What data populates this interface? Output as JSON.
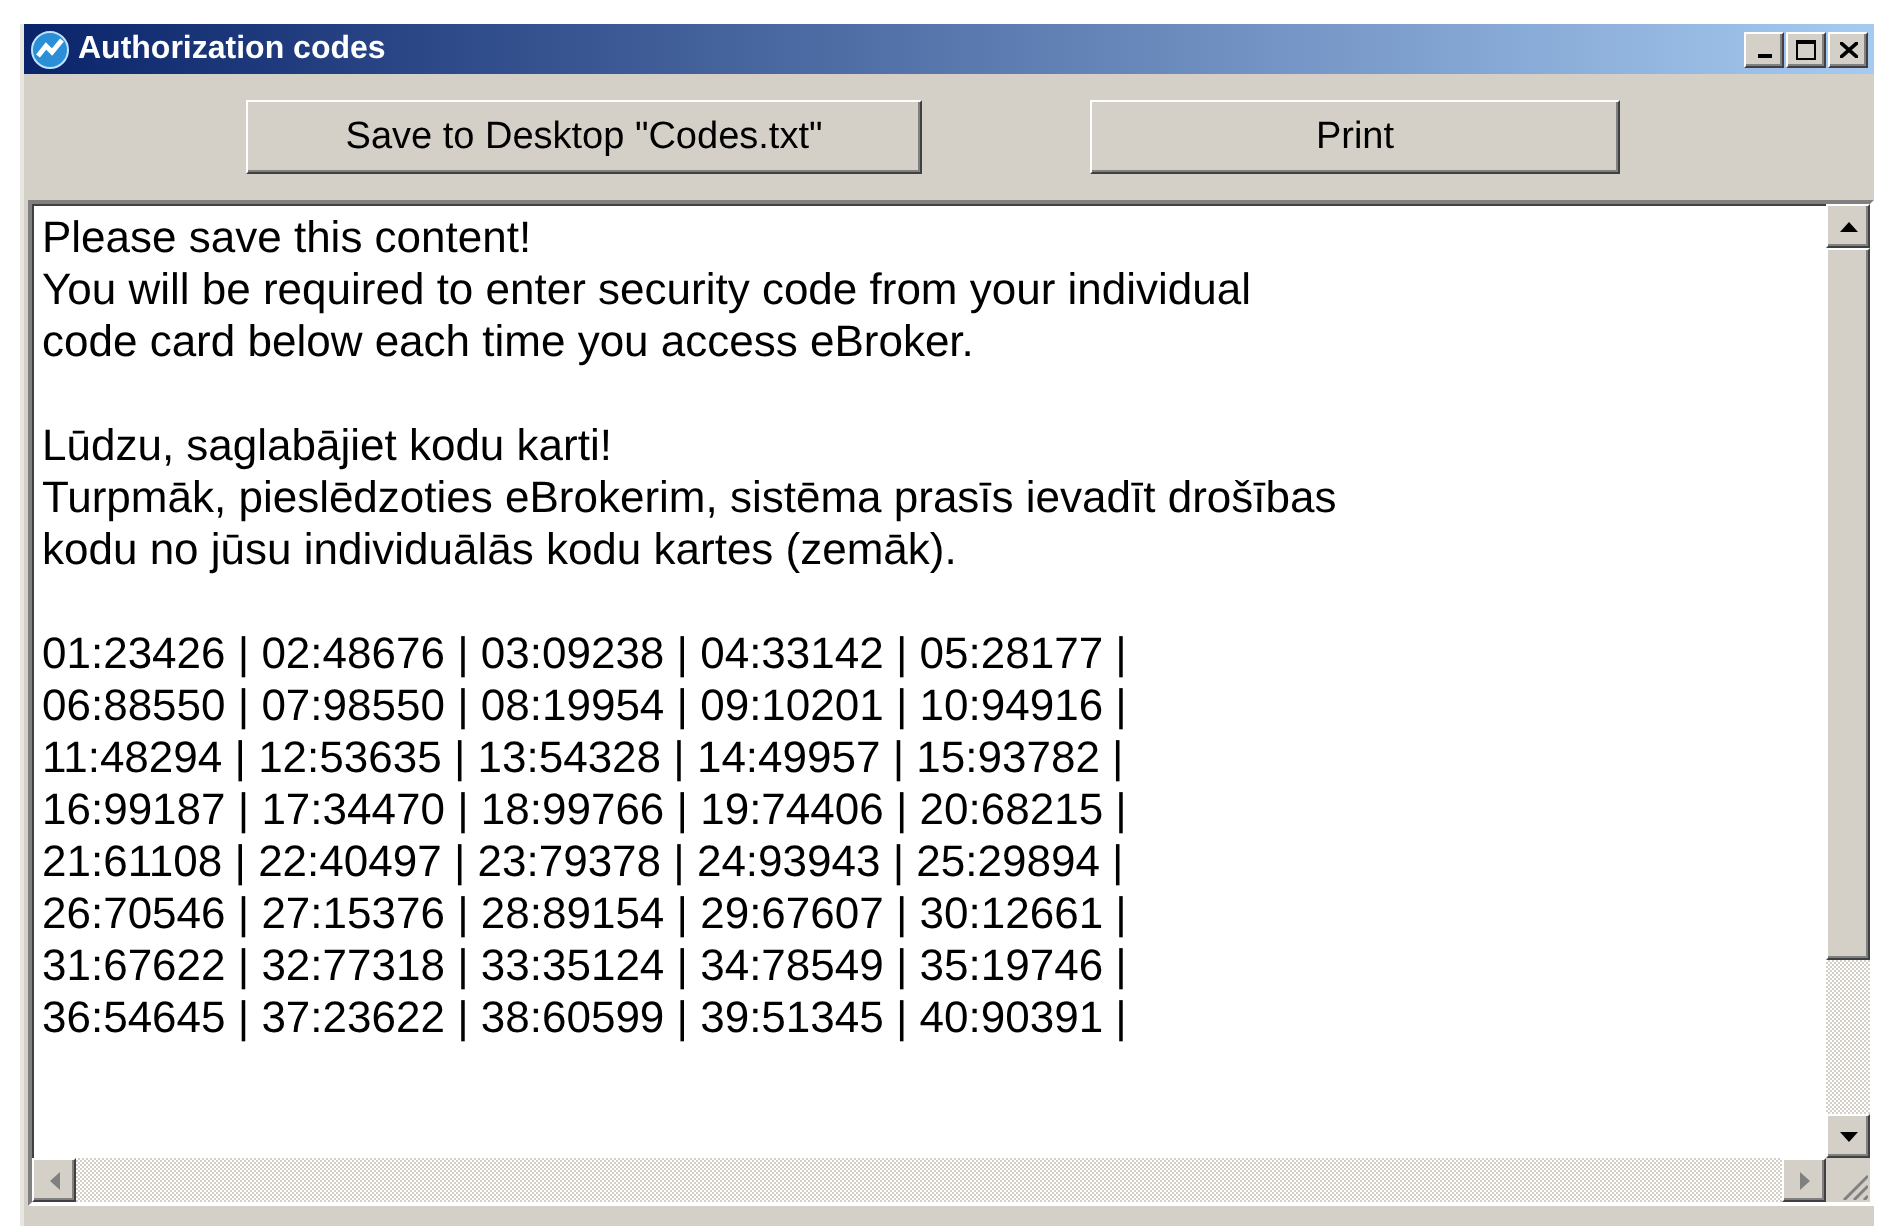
{
  "window": {
    "title": "Authorization codes"
  },
  "buttons": [
    {
      "label": "Save to Desktop \"Codes.txt\""
    },
    {
      "label": "Print"
    }
  ],
  "content": {
    "paragraphs": [
      [
        "Please save this content!",
        "You will be required to enter security code from your individual",
        "code card below each time you access eBroker."
      ],
      [
        "Lūdzu, saglabājiet kodu karti!",
        "Turpmāk, pieslēdzoties eBrokerim, sistēma prasīs ievadīt drošības",
        "kodu no jūsu individuālās kodu kartes (zemāk)."
      ],
      [
        "01:23426 | 02:48676 | 03:09238 | 04:33142 | 05:28177 |",
        "06:88550 | 07:98550 | 08:19954 | 09:10201 | 10:94916 |",
        "11:48294 | 12:53635 | 13:54328 | 14:49957 | 15:93782 |",
        "16:99187 | 17:34470 | 18:99766 | 19:74406 | 20:68215 |",
        "21:61108 | 22:40497 | 23:79378 | 24:93943 | 25:29894 |",
        "26:70546 | 27:15376 | 28:89154 | 29:67607 | 30:12661 |",
        "31:67622 | 32:77318 | 33:35124 | 34:78549 | 35:19746 |",
        "36:54645 | 37:23622 | 38:60599 | 39:51345 | 40:90391 |"
      ]
    ]
  }
}
